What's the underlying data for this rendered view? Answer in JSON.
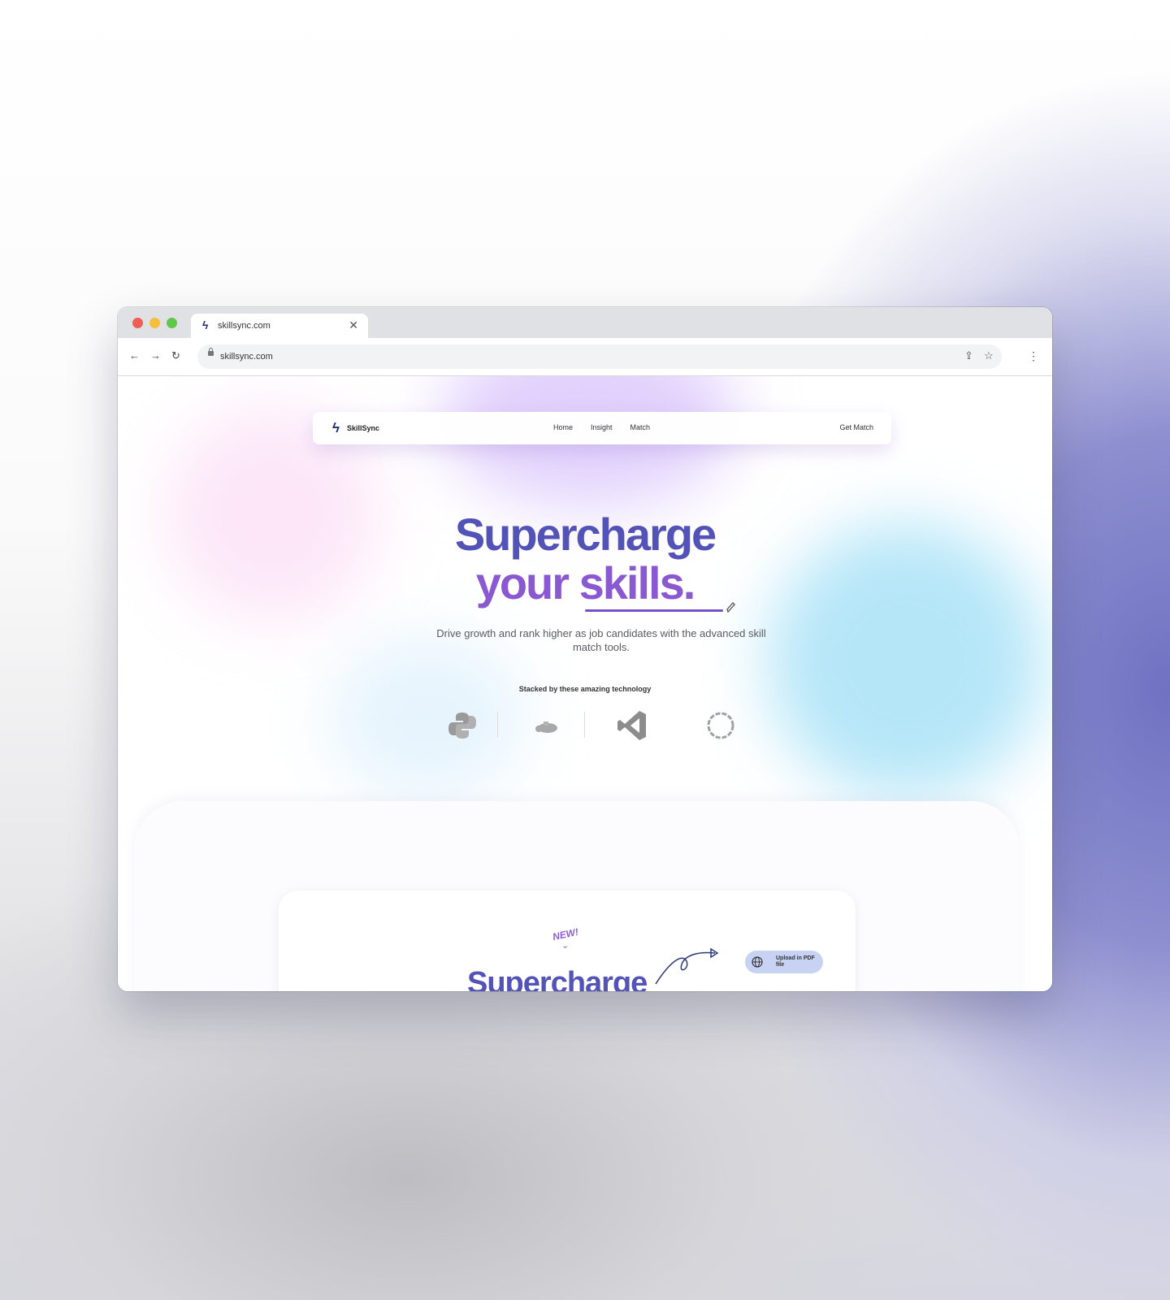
{
  "browser": {
    "tab_title": "skillsync.com",
    "url": "skillsync.com"
  },
  "site": {
    "brand": "SkillSync",
    "nav_links": [
      "Home",
      "Insight",
      "Match"
    ],
    "cta": "Get Match"
  },
  "hero": {
    "line1": "Supercharge",
    "line2": "your skills.",
    "subtitle": "Drive growth and rank higher as job candidates with the advanced skill match tools.",
    "stack_caption": "Stacked by these amazing technology",
    "tech_icons": [
      "python-icon",
      "docker-icon",
      "vscode-icon",
      "ring-icon"
    ]
  },
  "section2": {
    "new_label": "NEW!",
    "title": "Supercharge",
    "upload_button": "Upload in PDF file"
  },
  "colors": {
    "hero_primary": "#5352b6",
    "hero_secondary": "#8a58d0"
  }
}
